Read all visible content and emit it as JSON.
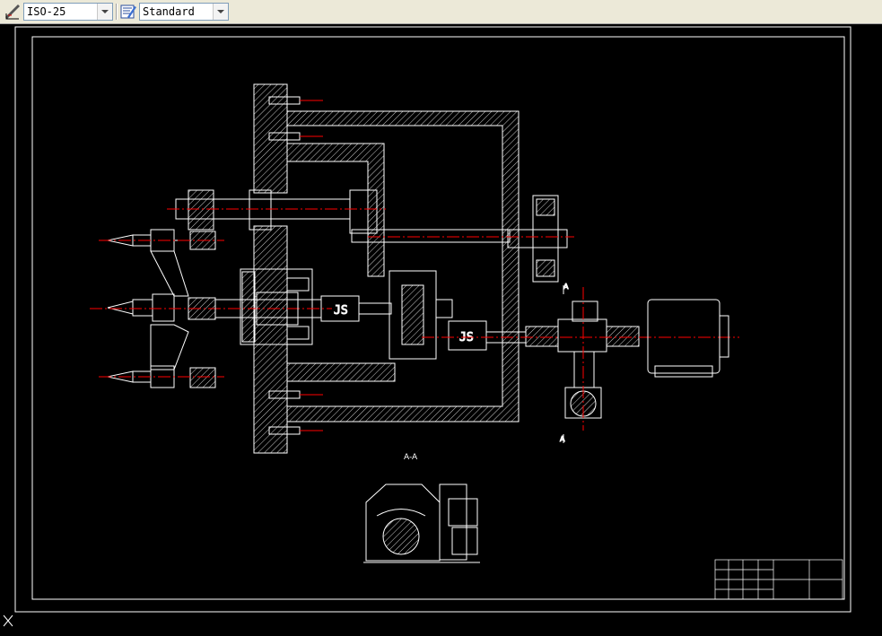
{
  "toolbar": {
    "dimstyle_icon": "dimension-style-icon",
    "dimstyle_value": "ISO-25",
    "textstyle_icon": "text-style-icon",
    "textstyle_value": "Standard"
  },
  "drawing": {
    "section_label": "A-A",
    "section_mark_top": "A",
    "section_mark_bottom": "A",
    "coupling_label_1": "JS",
    "coupling_label_2": "JS"
  },
  "colors": {
    "background": "#000000",
    "lines": "#ffffff",
    "centerlines": "#ff0000",
    "toolbar": "#ece9d8"
  },
  "ucs_icon": "ucs-icon"
}
